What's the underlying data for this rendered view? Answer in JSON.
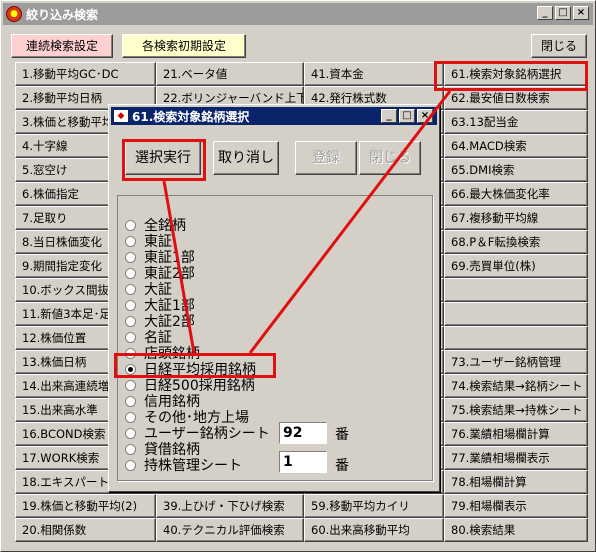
{
  "window": {
    "title": "絞り込み検索",
    "icon": "search-app-icon",
    "min": "_",
    "max": "□",
    "close": "×"
  },
  "toolbar": {
    "continuous": "連続検索設定",
    "init": "各検索初期設定",
    "close": "閉じる"
  },
  "columns": [
    [
      "1.移動平均GC･DC",
      "2.移動平均日柄",
      "3.株価と移動平均",
      "4.十字線",
      "5.窓空け",
      "6.株価指定",
      "7.足取り",
      "8.当日株価変化",
      "9.期間指定変化",
      "10.ボックス間抜け",
      "11.新値3本足･足",
      "12.株価位置",
      "13.株価日柄",
      "14.出来高連続増",
      "15.出来高水準",
      "16.BCOND検索",
      "17.WORK検索",
      "18.エキスパート推",
      "19.株価と移動平均(2)",
      "20.相関係数"
    ],
    [
      "21.ベータ値",
      "22.ボリンジャーバンド上下抜",
      "",
      "",
      "",
      "",
      "",
      "",
      "",
      "",
      "",
      "",
      "",
      "",
      "",
      "",
      "",
      "",
      "39.上ひげ・下ひげ検索",
      "40.テクニカル評価検索"
    ],
    [
      "41.資本金",
      "42.発行株式数",
      "",
      "",
      "",
      "",
      "",
      "",
      "",
      "",
      "",
      "",
      "",
      "",
      "",
      "",
      "",
      "",
      "59.移動平均カイリ",
      "60.出来高移動平均"
    ],
    [
      "61.検索対象銘柄選択",
      "62.最安値日数検索",
      "63.13配当金",
      "64.MACD検索",
      "65.DMI検索",
      "66.最大株価変化率",
      "67.複移動平均線",
      "68.P＆F転換検索",
      "69.売買単位(株)",
      "",
      "",
      "",
      "73.ユーザー銘柄管理",
      "74.検索結果→銘柄シート",
      "75.検索結果→持株シート",
      "76.業績相場欄計算",
      "77.業績相場欄表示",
      "78.相場欄計算",
      "79.相場欄表示",
      "80.検索結果"
    ]
  ],
  "dialog": {
    "title": "61.検索対象銘柄選択",
    "buttons": {
      "select": "選択実行",
      "cancel": "取り消し",
      "register": "登録",
      "close": "閉じる"
    },
    "options": [
      "全銘柄",
      "東証",
      "東証1部",
      "東証2部",
      "大証",
      "大証1部",
      "大証2部",
      "名証",
      "店頭銘柄",
      "日経平均採用銘柄",
      "日経500採用銘柄",
      "信用銘柄",
      "その他･地方上場",
      "ユーザー銘柄シート",
      "貸借銘柄",
      "持株管理シート"
    ],
    "selected_index": 9,
    "user_sheet_number": "92",
    "holdings_sheet_number": "1",
    "ban_label": "番"
  },
  "colors": {
    "highlight": "#e01010",
    "dialog_title": "#0a246a",
    "window_title": "#9c9c9c"
  }
}
